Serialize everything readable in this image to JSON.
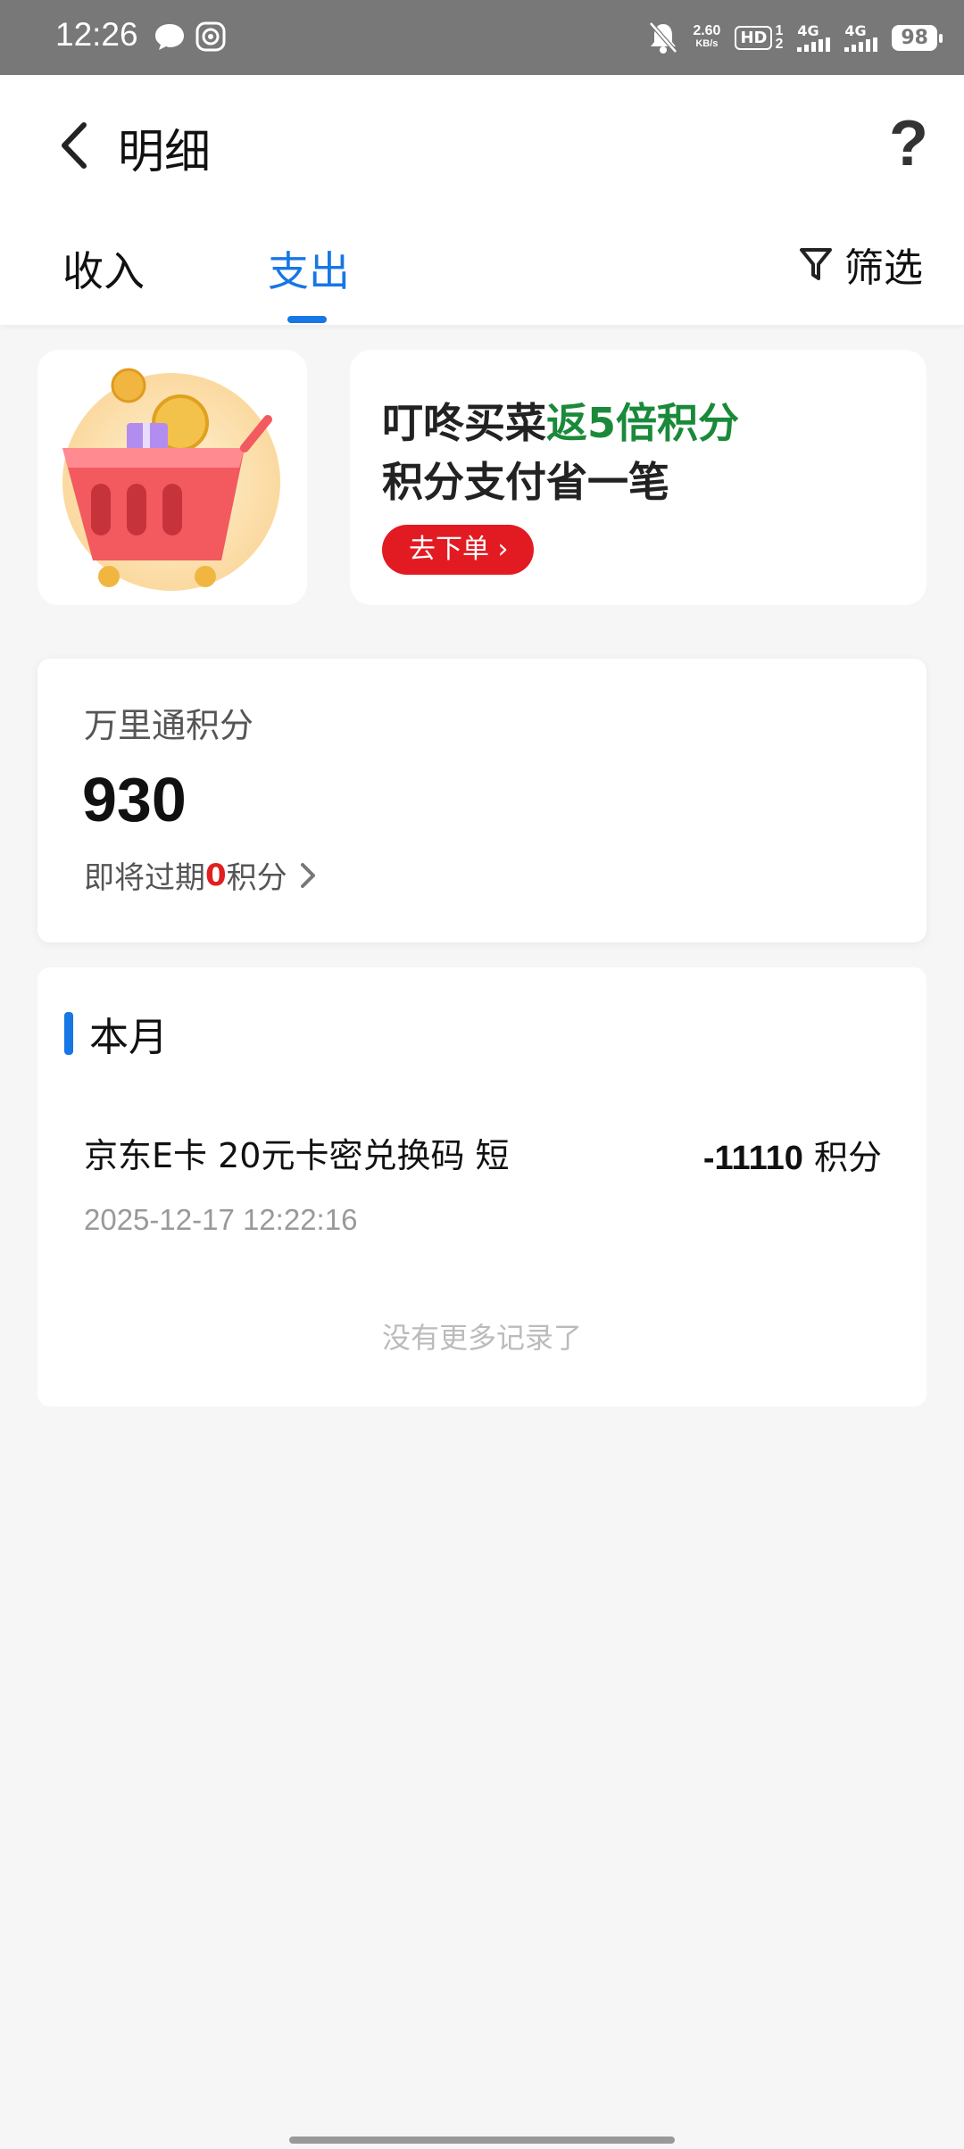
{
  "status_bar": {
    "time": "12:26",
    "net_speed_value": "2.60",
    "net_speed_unit": "KB/s",
    "hd_label": "HD",
    "hd_sim_top": "1",
    "hd_sim_bottom": "2",
    "sim1_label": "4G",
    "sim2_label": "4G",
    "battery": "98",
    "icons": [
      "chat-bubble-icon",
      "shield-face-icon",
      "bell-off-icon",
      "signal-icon",
      "battery-icon"
    ]
  },
  "header": {
    "title": "明细",
    "help_label": "?"
  },
  "tabs": {
    "income": "收入",
    "expense": "支出",
    "active": "支出",
    "filter_label": "筛选"
  },
  "banner": {
    "line1_prefix": "叮咚买菜",
    "line1_highlight": "返5倍积分",
    "line2": "积分支付省一笔",
    "button_label": "去下单 ›"
  },
  "points": {
    "label": "万里通积分",
    "value": "930",
    "expire_prefix": "即将过期",
    "expire_count": "0",
    "expire_suffix": "积分"
  },
  "month": {
    "title": "本月",
    "records": [
      {
        "name": "京东E卡 20元卡密兑换码 短",
        "amount": "-11110",
        "unit": "积分",
        "time": "2025-12-17 12:22:16"
      }
    ],
    "no_more": "没有更多记录了"
  },
  "colors": {
    "accent": "#1677e5",
    "banner_green": "#1a8a3a",
    "banner_button": "#e21b23",
    "expire_red": "#e02020"
  }
}
